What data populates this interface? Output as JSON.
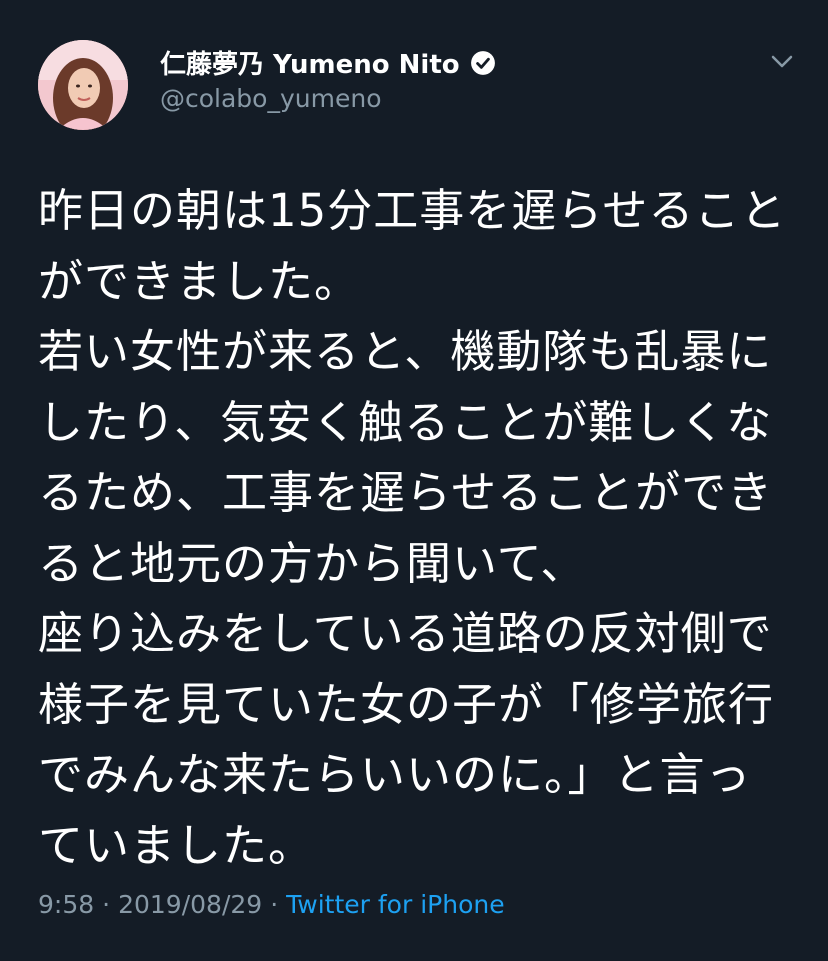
{
  "header": {
    "display_name": "仁藤夢乃 Yumeno Nito",
    "handle": "@colabo_yumeno"
  },
  "tweet": {
    "lines": [
      "昨日の朝は15分工事を遅らせること",
      "ができました。",
      "若い女性が来ると、機動隊も乱暴に",
      "したり、気安く触ることが難しくな",
      "るため、工事を遅らせることができ",
      "ると地元の方から聞いて、",
      "座り込みをしている道路の反対側で",
      "様子を見ていた女の子が「修学旅行",
      "でみんな来たらいいのに。」と言っ",
      "ていました。"
    ]
  },
  "meta": {
    "time": "9:58",
    "separator1": "·",
    "date": "2019/08/29",
    "separator2": "·",
    "source": "Twitter for iPhone"
  },
  "colors": {
    "background": "#141c26",
    "secondary_text": "#8899a6",
    "link": "#1da1f2"
  },
  "icons": {
    "verified": "verified-badge-icon",
    "caret": "chevron-down-icon"
  }
}
